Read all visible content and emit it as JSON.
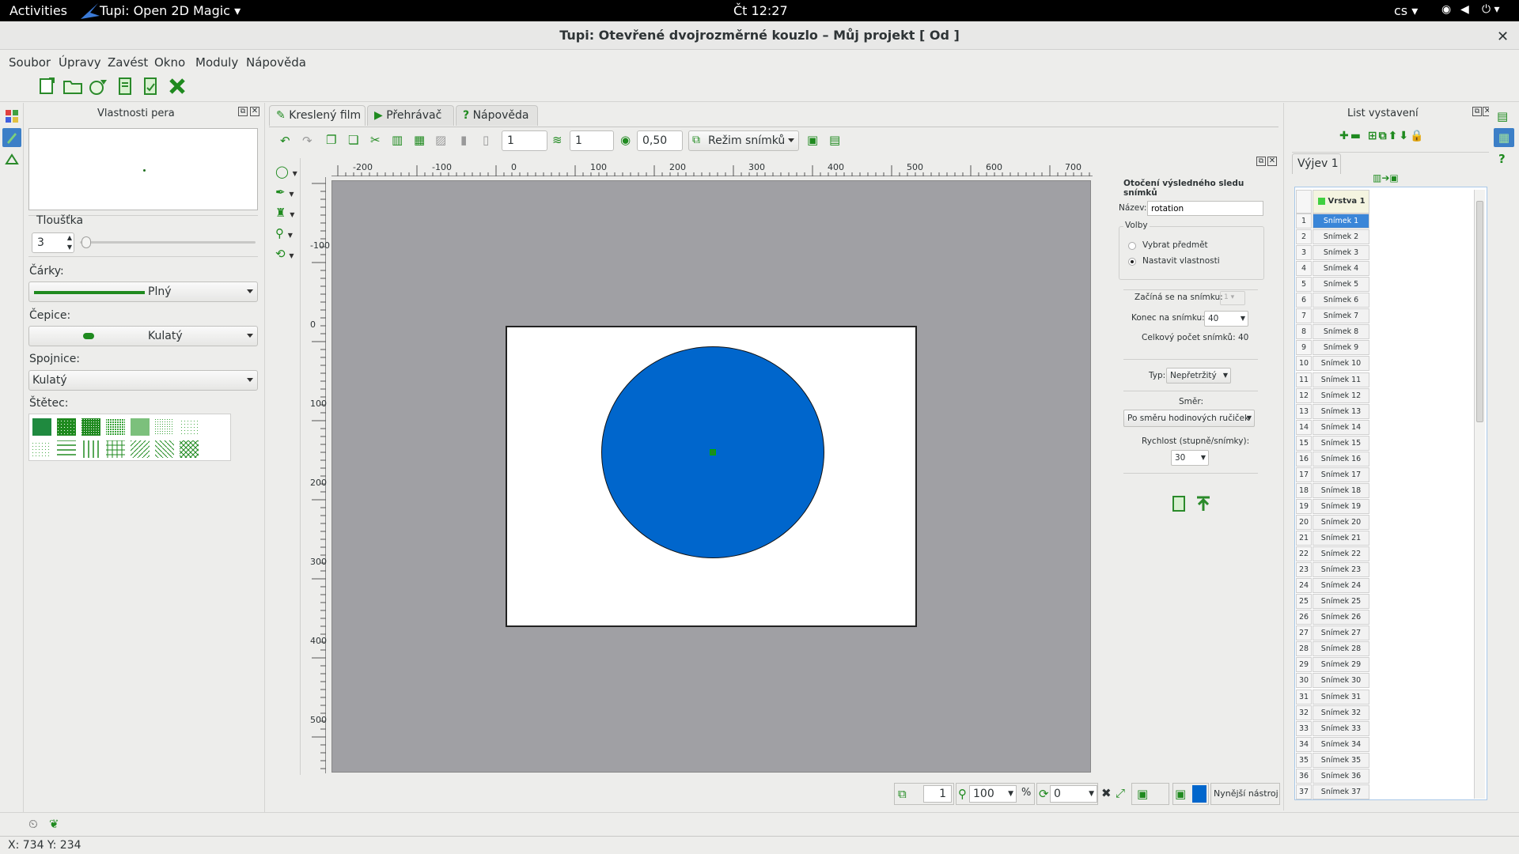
{
  "topbar": {
    "activities": "Activities",
    "app_menu": "Tupi: Open 2D Magic",
    "clock": "Čt 12:27",
    "lang": "cs"
  },
  "window": {
    "title": "Tupi: Otevřené dvojrozměrné kouzlo – Můj projekt [ Od ]"
  },
  "menu": {
    "items": [
      "Soubor",
      "Úpravy",
      "Zavést",
      "Okno",
      "Moduly",
      "Nápověda"
    ]
  },
  "pen_panel": {
    "title": "Vlastnosti pera",
    "thickness_label": "Tloušťka",
    "thickness_value": "3",
    "dashes_label": "Čárky:",
    "dashes_value": "Plný",
    "caps_label": "Čepice:",
    "caps_value": "Kulatý",
    "joins_label": "Spojnice:",
    "joins_value": "Kulatý",
    "brush_label": "Štětec:"
  },
  "tabs": {
    "film": "Kreslený film",
    "player": "Přehrávač",
    "help": "Nápověda"
  },
  "canvas_toolbar": {
    "frame1": "1",
    "frame2": "1",
    "opacity": "0,50",
    "mode": "Režim snímků"
  },
  "ruler": {
    "h": [
      "-200",
      "-100",
      "0",
      "100",
      "200",
      "300",
      "400",
      "500",
      "600",
      "700"
    ],
    "v": [
      "-100",
      "0",
      "100",
      "200",
      "300",
      "400",
      "500"
    ]
  },
  "tween": {
    "title": "Otočení výsledného sledu snímků",
    "name_label": "Název:",
    "name_value": "rotation",
    "options_label": "Volby",
    "opt_select": "Vybrat předmět",
    "opt_props": "Nastavit vlastnosti",
    "start_label": "Začíná se na snímku:",
    "start_value": "1",
    "end_label": "Konec na snímku:",
    "end_value": "40",
    "total": "Celkový počet snímků: 40",
    "type_label": "Typ:",
    "type_value": "Nepřetržitý",
    "dir_label": "Směr:",
    "dir_value": "Po směru hodinových ručiček",
    "speed_label": "Rychlost (stupně/snímky):",
    "speed_value": "30"
  },
  "statusbar": {
    "frame": "1",
    "zoom": "100",
    "percent": "%",
    "rotation": "0",
    "current_tool": "Nynější nástroj"
  },
  "coords": "X: 734 Y: 234",
  "sheet": {
    "title": "List vystavení",
    "scene_tab": "Výjev 1",
    "layer": "Vrstva 1",
    "frames": [
      "Snímek 1",
      "Snímek 2",
      "Snímek 3",
      "Snímek 4",
      "Snímek 5",
      "Snímek 6",
      "Snímek 7",
      "Snímek 8",
      "Snímek 9",
      "Snímek 10",
      "Snímek 11",
      "Snímek 12",
      "Snímek 13",
      "Snímek 14",
      "Snímek 15",
      "Snímek 16",
      "Snímek 17",
      "Snímek 18",
      "Snímek 19",
      "Snímek 20",
      "Snímek 21",
      "Snímek 22",
      "Snímek 23",
      "Snímek 24",
      "Snímek 25",
      "Snímek 26",
      "Snímek 27",
      "Snímek 28",
      "Snímek 29",
      "Snímek 30",
      "Snímek 31",
      "Snímek 32",
      "Snímek 33",
      "Snímek 34",
      "Snímek 35",
      "Snímek 36",
      "Snímek 37"
    ]
  },
  "colors": {
    "fill": "#0066cc",
    "accent": "#1a9a2a",
    "canvas_bg": "#a0a0a4"
  },
  "icons": [
    "new-file-icon",
    "open-folder-icon",
    "open-net-icon",
    "save-icon",
    "save-as-icon",
    "close-project-icon",
    "pencil-icon",
    "play-icon",
    "help-icon",
    "ellipse-tool-icon",
    "brush-tool-icon",
    "fill-tool-icon",
    "zoom-tool-icon",
    "tween-tool-icon"
  ]
}
